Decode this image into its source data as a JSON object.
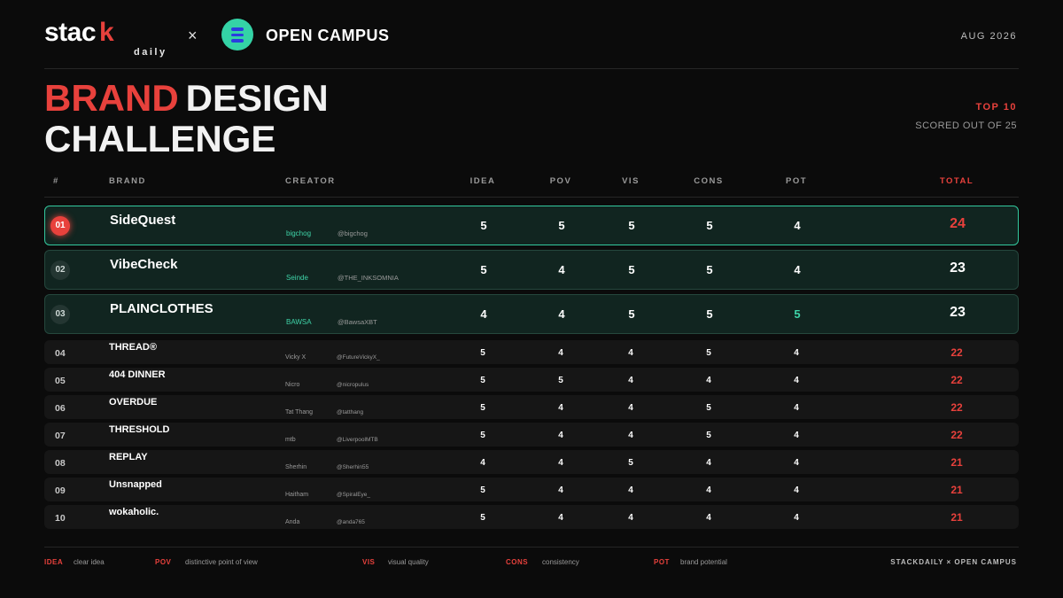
{
  "header": {
    "logo_main": "stac",
    "logo_k": "k",
    "logo_sub": "daily",
    "times": "×",
    "partner": "OPEN CAMPUS",
    "date": "AUG 2026"
  },
  "title": {
    "red": "BRAND",
    "white": "DESIGN",
    "line2": "CHALLENGE"
  },
  "meta": {
    "top": "TOP 10",
    "scored": "SCORED OUT OF 25"
  },
  "table": {
    "headers": {
      "rank": "#",
      "brand": "BRAND",
      "creator": "CREATOR",
      "idea": "IDEA",
      "pov": "POV",
      "vis": "VIS",
      "cons": "CONS",
      "pot": "POT",
      "total": "TOTAL"
    },
    "rows": [
      {
        "rank": "01",
        "brand": "SideQuest",
        "creator": "bigchog",
        "handle": "@bigchog",
        "idea": "5",
        "pov": "5",
        "vis": "5",
        "cons": "5",
        "pot": "4",
        "total": "24"
      },
      {
        "rank": "02",
        "brand": "VibeCheck",
        "creator": "Seinde",
        "handle": "@THE_INKSOMNIA",
        "idea": "5",
        "pov": "4",
        "vis": "5",
        "cons": "5",
        "pot": "4",
        "total": "23"
      },
      {
        "rank": "03",
        "brand": "PLAINCLOTHES",
        "creator": "BAWSA",
        "handle": "@BawsaXBT",
        "idea": "4",
        "pov": "4",
        "vis": "5",
        "cons": "5",
        "pot": "5",
        "total": "23"
      },
      {
        "rank": "04",
        "brand": "THREAD®",
        "creator": "Vicky X",
        "handle": "@FutureVickyX_",
        "idea": "5",
        "pov": "4",
        "vis": "4",
        "cons": "5",
        "pot": "4",
        "total": "22"
      },
      {
        "rank": "05",
        "brand": "404 DINNER",
        "creator": "Nicro",
        "handle": "@nicropulus",
        "idea": "5",
        "pov": "5",
        "vis": "4",
        "cons": "4",
        "pot": "4",
        "total": "22"
      },
      {
        "rank": "06",
        "brand": "OVERDUE",
        "creator": "Tat Thang",
        "handle": "@tatthang",
        "idea": "5",
        "pov": "4",
        "vis": "4",
        "cons": "5",
        "pot": "4",
        "total": "22"
      },
      {
        "rank": "07",
        "brand": "THRESHOLD",
        "creator": "mtb",
        "handle": "@LiverpoolMTB",
        "idea": "5",
        "pov": "4",
        "vis": "4",
        "cons": "5",
        "pot": "4",
        "total": "22"
      },
      {
        "rank": "08",
        "brand": "REPLAY",
        "creator": "Sherhin",
        "handle": "@Sherhin55",
        "idea": "4",
        "pov": "4",
        "vis": "5",
        "cons": "4",
        "pot": "4",
        "total": "21"
      },
      {
        "rank": "09",
        "brand": "Unsnapped",
        "creator": "Haitham",
        "handle": "@SpiralEye_",
        "idea": "5",
        "pov": "4",
        "vis": "4",
        "cons": "4",
        "pot": "4",
        "total": "21"
      },
      {
        "rank": "10",
        "brand": "wokaholic.",
        "creator": "Anda",
        "handle": "@anda765",
        "idea": "5",
        "pov": "4",
        "vis": "4",
        "cons": "4",
        "pot": "4",
        "total": "21"
      }
    ]
  },
  "legend": {
    "idea_abbr": "IDEA",
    "idea_desc": "clear idea",
    "pov_abbr": "POV",
    "pov_desc": "distinctive point of view",
    "vis_abbr": "VIS",
    "vis_desc": "visual quality",
    "cons_abbr": "CONS",
    "cons_desc": "consistency",
    "pot_abbr": "POT",
    "pot_desc": "brand potential",
    "credit": "STACKDAILY × OPEN CAMPUS"
  },
  "colors": {
    "accent_red": "#e8413c",
    "accent_green": "#3fd4a8",
    "oc_logo": "#34d3a6",
    "oc_logo_bars": "#2b3ddf"
  },
  "icons": {
    "partner_logo": "open-campus-logo-icon"
  }
}
